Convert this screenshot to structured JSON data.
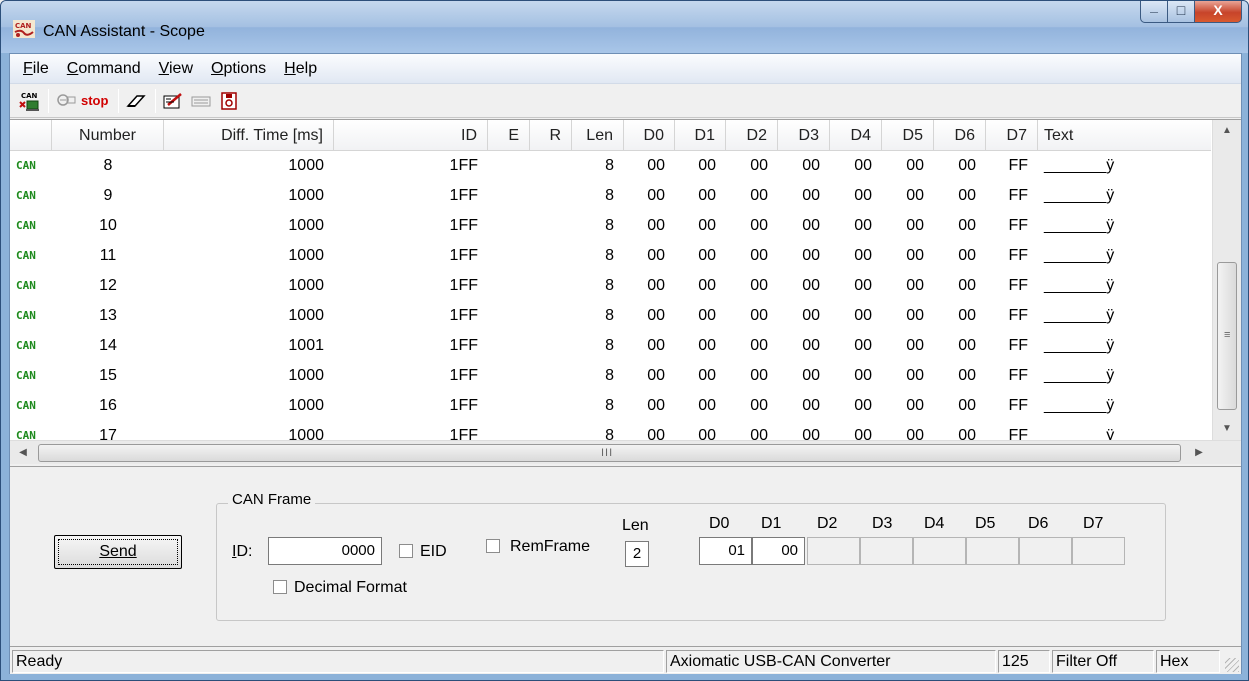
{
  "window": {
    "title": "CAN Assistant - Scope",
    "controls": {
      "minimize": "_",
      "maximize": "□",
      "close": "X"
    }
  },
  "menu": [
    {
      "key": "F",
      "rest": "ile"
    },
    {
      "key": "C",
      "rest": "ommand"
    },
    {
      "key": "V",
      "rest": "iew"
    },
    {
      "key": "O",
      "rest": "ptions"
    },
    {
      "key": "H",
      "rest": "elp"
    }
  ],
  "toolbar": {
    "connect_icon_text": "CAN",
    "stop_label": "stop",
    "icons": [
      "can-connect-icon",
      "loupe-icon",
      "stop-icon",
      "eraser-icon",
      "edit-icon",
      "list-icon",
      "save-icon"
    ]
  },
  "grid": {
    "columns": [
      "",
      "Number",
      "Diff. Time [ms]",
      "ID",
      "E",
      "R",
      "Len",
      "D0",
      "D1",
      "D2",
      "D3",
      "D4",
      "D5",
      "D6",
      "D7",
      "Text"
    ],
    "rows": [
      [
        "CAN",
        "8",
        "1000",
        "1FF",
        "",
        "",
        "8",
        "00",
        "00",
        "00",
        "00",
        "00",
        "00",
        "00",
        "FF",
        "_______ÿ"
      ],
      [
        "CAN",
        "9",
        "1000",
        "1FF",
        "",
        "",
        "8",
        "00",
        "00",
        "00",
        "00",
        "00",
        "00",
        "00",
        "FF",
        "_______ÿ"
      ],
      [
        "CAN",
        "10",
        "1000",
        "1FF",
        "",
        "",
        "8",
        "00",
        "00",
        "00",
        "00",
        "00",
        "00",
        "00",
        "FF",
        "_______ÿ"
      ],
      [
        "CAN",
        "11",
        "1000",
        "1FF",
        "",
        "",
        "8",
        "00",
        "00",
        "00",
        "00",
        "00",
        "00",
        "00",
        "FF",
        "_______ÿ"
      ],
      [
        "CAN",
        "12",
        "1000",
        "1FF",
        "",
        "",
        "8",
        "00",
        "00",
        "00",
        "00",
        "00",
        "00",
        "00",
        "FF",
        "_______ÿ"
      ],
      [
        "CAN",
        "13",
        "1000",
        "1FF",
        "",
        "",
        "8",
        "00",
        "00",
        "00",
        "00",
        "00",
        "00",
        "00",
        "FF",
        "_______ÿ"
      ],
      [
        "CAN",
        "14",
        "1001",
        "1FF",
        "",
        "",
        "8",
        "00",
        "00",
        "00",
        "00",
        "00",
        "00",
        "00",
        "FF",
        "_______ÿ"
      ],
      [
        "CAN",
        "15",
        "1000",
        "1FF",
        "",
        "",
        "8",
        "00",
        "00",
        "00",
        "00",
        "00",
        "00",
        "00",
        "FF",
        "_______ÿ"
      ],
      [
        "CAN",
        "16",
        "1000",
        "1FF",
        "",
        "",
        "8",
        "00",
        "00",
        "00",
        "00",
        "00",
        "00",
        "00",
        "FF",
        "_______ÿ"
      ],
      [
        "CAN",
        "17",
        "1000",
        "1FF",
        "",
        "",
        "8",
        "00",
        "00",
        "00",
        "00",
        "00",
        "00",
        "00",
        "FF",
        "_______ÿ"
      ]
    ],
    "hscroll_grip": "III",
    "vscroll_grip": "≡"
  },
  "send_panel": {
    "send_label": "Send",
    "group_title": "CAN Frame",
    "id_label": "ID:",
    "id_value": "0000",
    "eid_label": "EID",
    "remframe_label": "RemFrame",
    "decimal_label": "Decimal Format",
    "len_label": "Len",
    "len_value": "2",
    "data_labels": [
      "D0",
      "D1",
      "D2",
      "D3",
      "D4",
      "D5",
      "D6",
      "D7"
    ],
    "data_values": [
      "01",
      "00",
      "",
      "",
      "",
      "",
      "",
      ""
    ]
  },
  "status": {
    "ready": "Ready",
    "device": "Axiomatic USB-CAN Converter",
    "baud": "125",
    "filter": "Filter Off",
    "format": "Hex"
  }
}
